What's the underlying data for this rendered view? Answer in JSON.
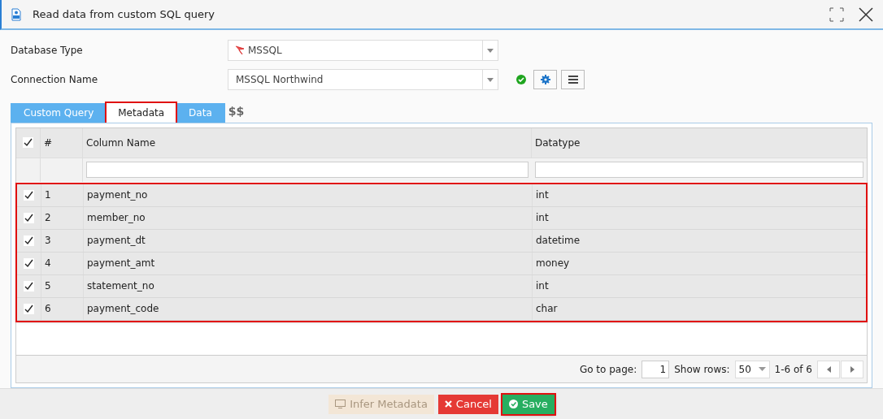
{
  "window": {
    "title": "Read data from custom SQL query"
  },
  "form": [
    {
      "label": "Database Type",
      "value": "MSSQL",
      "has_db_icon": true
    },
    {
      "label": "Connection Name",
      "value": "MSSQL Northwind",
      "has_db_icon": false
    }
  ],
  "connection_ok": true,
  "tabs": [
    {
      "label": "Custom Query",
      "selected": false,
      "highlighted": false
    },
    {
      "label": "Metadata",
      "selected": true,
      "highlighted": true
    },
    {
      "label": "Data",
      "selected": false,
      "highlighted": false
    }
  ],
  "tab_extra": "$$",
  "table": {
    "columns": [
      "#",
      "Column Name",
      "Datatype"
    ],
    "header_checked": true,
    "rows_highlighted": true,
    "rows": [
      {
        "checked": true,
        "cells": [
          "1",
          "payment_no",
          "int"
        ]
      },
      {
        "checked": true,
        "cells": [
          "2",
          "member_no",
          "int"
        ]
      },
      {
        "checked": true,
        "cells": [
          "3",
          "payment_dt",
          "datetime"
        ]
      },
      {
        "checked": true,
        "cells": [
          "4",
          "payment_amt",
          "money"
        ]
      },
      {
        "checked": true,
        "cells": [
          "5",
          "statement_no",
          "int"
        ]
      },
      {
        "checked": true,
        "cells": [
          "6",
          "payment_code",
          "char"
        ]
      }
    ]
  },
  "pager": {
    "goto_label": "Go to page:",
    "page": "1",
    "rows_label": "Show rows:",
    "rows_value": "50",
    "range": "1-6 of 6"
  },
  "buttons": [
    {
      "kind": "infer",
      "label": "Infer Metadata",
      "disabled": true,
      "highlighted": false
    },
    {
      "kind": "cancel",
      "label": "Cancel",
      "disabled": false,
      "highlighted": false
    },
    {
      "kind": "save",
      "label": "Save",
      "disabled": false,
      "highlighted": true
    }
  ]
}
